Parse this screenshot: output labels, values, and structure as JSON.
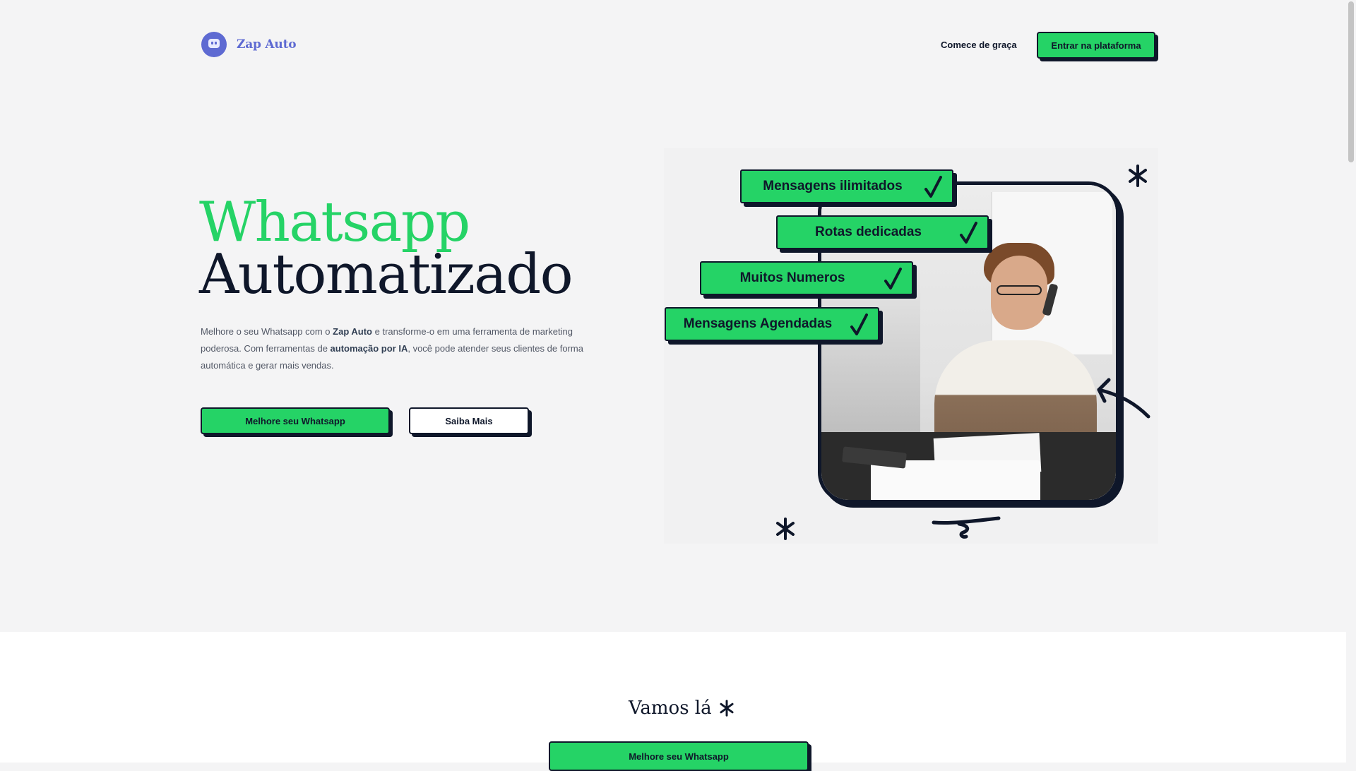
{
  "header": {
    "logo_text": "Zap Auto",
    "nav_link": "Comece de graça",
    "cta_label": "Entrar na plataforma"
  },
  "hero": {
    "title_line1": "Whatsapp",
    "title_line2": "Automatizado",
    "description_parts": {
      "p1": "Melhore o seu Whatsapp com o ",
      "b1": "Zap Auto",
      "p2": " e transforme-o em uma ferramenta de marketing poderosa. Com ferramentas de ",
      "b2": "automação por IA",
      "p3": ", você pode atender seus clientes de forma automática e gerar mais vendas."
    },
    "primary_button": "Melhore seu Whatsapp",
    "secondary_button": "Saiba Mais"
  },
  "features": [
    "Mensagens ilimitados",
    "Rotas dedicadas",
    "Muitos Numeros",
    "Mensagens Agendadas"
  ],
  "lower": {
    "heading": "Vamos lá",
    "button": "Melhore seu Whatsapp"
  },
  "colors": {
    "brand_green": "#25d366",
    "dark_navy": "#0f172a",
    "logo_purple": "#5e6ad2",
    "background": "#f4f4f5"
  },
  "icons": [
    "robot-chat-icon",
    "check-icon",
    "asterisk-icon",
    "arrow-icon",
    "squiggle-icon"
  ]
}
